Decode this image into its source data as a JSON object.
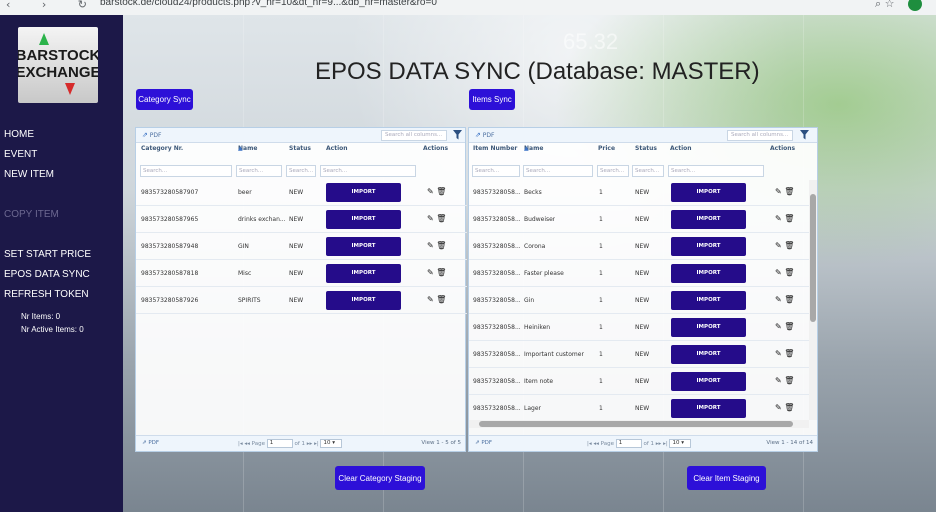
{
  "browser": {
    "url": "barstock.de/cloud24/products.php?v_nr=10&dt_nr=9...&db_nr=master&ro=0"
  },
  "sidebar": {
    "logo_text": "BARSTOCK EXCHANGE",
    "items": [
      {
        "label": "HOME",
        "enabled": true
      },
      {
        "label": "EVENT",
        "enabled": true
      },
      {
        "label": "NEW ITEM",
        "enabled": true
      },
      {
        "label": "",
        "enabled": true
      },
      {
        "label": "COPY ITEM",
        "enabled": false
      },
      {
        "label": "",
        "enabled": true
      },
      {
        "label": "SET START PRICE",
        "enabled": true
      },
      {
        "label": "EPOS DATA SYNC",
        "enabled": true
      },
      {
        "label": "REFRESH TOKEN",
        "enabled": true
      }
    ],
    "stats": {
      "nr_items": "Nr Items: 0",
      "nr_active_items": "Nr Active Items: 0"
    }
  },
  "background": {
    "figure": "65.32"
  },
  "page": {
    "title": "EPOS DATA SYNC (Database: MASTER)"
  },
  "category_grid": {
    "sync_button": "Category Sync",
    "pdf_label": "PDF",
    "search_all_placeholder": "Search all columns...",
    "columns": [
      "Category Nr.",
      "Name",
      "Status",
      "Action",
      "Actions"
    ],
    "search_placeholders": [
      "Search...",
      "Search...",
      "Search...",
      "Search..."
    ],
    "rows": [
      {
        "nr": "983573280587907",
        "name": "beer",
        "status": "NEW",
        "action": "IMPORT"
      },
      {
        "nr": "983573280587965",
        "name": "drinks exchan...",
        "status": "NEW",
        "action": "IMPORT"
      },
      {
        "nr": "983573280587948",
        "name": "GIN",
        "status": "NEW",
        "action": "IMPORT"
      },
      {
        "nr": "983573280587818",
        "name": "Misc",
        "status": "NEW",
        "action": "IMPORT"
      },
      {
        "nr": "983573280587926",
        "name": "SPIRITS",
        "status": "NEW",
        "action": "IMPORT"
      }
    ],
    "pager": {
      "page_label": "Page",
      "page": "1",
      "of": "of 1",
      "page_size": "10",
      "view": "View 1 - 5 of 5"
    },
    "clear_button": "Clear Category Staging"
  },
  "items_grid": {
    "sync_button": "Items Sync",
    "pdf_label": "PDF",
    "search_all_placeholder": "Search all columns...",
    "columns": [
      "Item Number",
      "Name",
      "Price",
      "Status",
      "Action",
      "Actions"
    ],
    "search_placeholders": [
      "Search...",
      "Search...",
      "Search...",
      "Search...",
      "Search..."
    ],
    "rows": [
      {
        "nr": "98357328058...",
        "name": "Becks",
        "price": "1",
        "status": "NEW",
        "action": "IMPORT"
      },
      {
        "nr": "98357328058...",
        "name": "Budweiser",
        "price": "1",
        "status": "NEW",
        "action": "IMPORT"
      },
      {
        "nr": "98357328058...",
        "name": "Corona",
        "price": "1",
        "status": "NEW",
        "action": "IMPORT"
      },
      {
        "nr": "98357328058...",
        "name": "Faster please",
        "price": "1",
        "status": "NEW",
        "action": "IMPORT"
      },
      {
        "nr": "98357328058...",
        "name": "Gin",
        "price": "1",
        "status": "NEW",
        "action": "IMPORT"
      },
      {
        "nr": "98357328058...",
        "name": "Heiniken",
        "price": "1",
        "status": "NEW",
        "action": "IMPORT"
      },
      {
        "nr": "98357328058...",
        "name": "Important customer",
        "price": "1",
        "status": "NEW",
        "action": "IMPORT"
      },
      {
        "nr": "98357328058...",
        "name": "Item note",
        "price": "1",
        "status": "NEW",
        "action": "IMPORT"
      },
      {
        "nr": "98357328058...",
        "name": "Lager",
        "price": "1",
        "status": "NEW",
        "action": "IMPORT"
      }
    ],
    "pager": {
      "page_label": "Page",
      "page": "1",
      "of": "of 1",
      "page_size": "10",
      "view": "View 1 - 14 of 14"
    },
    "clear_button": "Clear Item Staging"
  },
  "colors": {
    "sidebar_bg": "#1c1848",
    "accent_button": "#2d10d8",
    "import_button": "#250c8a"
  }
}
